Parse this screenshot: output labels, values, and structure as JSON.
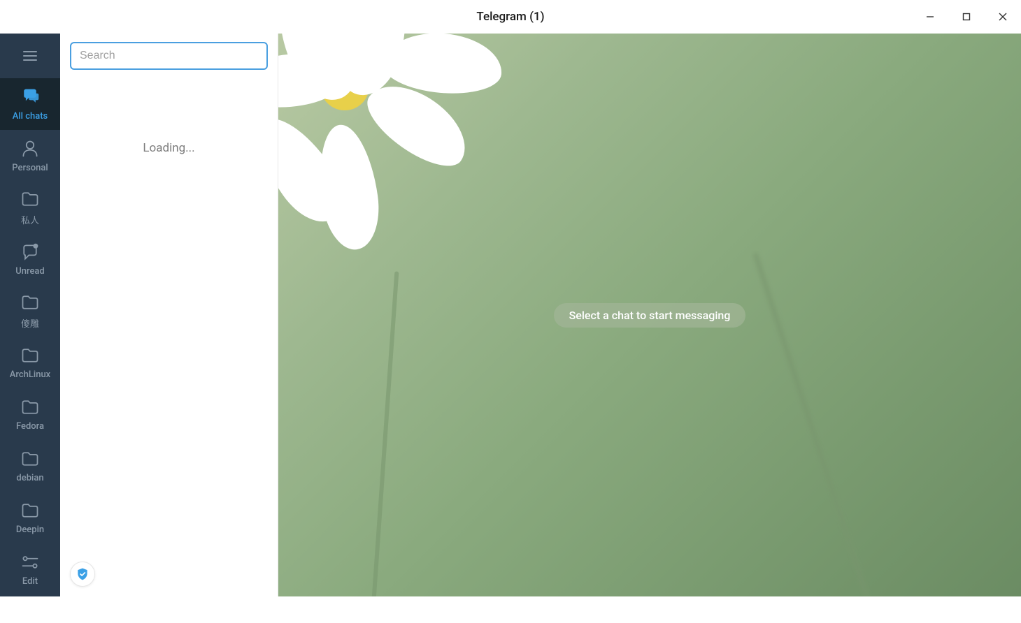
{
  "window": {
    "title": "Telegram (1)"
  },
  "search": {
    "placeholder": "Search",
    "value": ""
  },
  "chatlist": {
    "loading_text": "Loading..."
  },
  "sidebar": {
    "folders": [
      {
        "id": "all-chats",
        "label": "All chats",
        "icon": "chats",
        "active": true
      },
      {
        "id": "personal",
        "label": "Personal",
        "icon": "person",
        "active": false
      },
      {
        "id": "private",
        "label": "私人",
        "icon": "folder",
        "active": false
      },
      {
        "id": "unread",
        "label": "Unread",
        "icon": "unread",
        "active": false
      },
      {
        "id": "shadiao",
        "label": "傻雕",
        "icon": "folder",
        "active": false
      },
      {
        "id": "archlinux",
        "label": "ArchLinux",
        "icon": "folder",
        "active": false
      },
      {
        "id": "fedora",
        "label": "Fedora",
        "icon": "folder",
        "active": false
      },
      {
        "id": "debian",
        "label": "debian",
        "icon": "folder",
        "active": false
      },
      {
        "id": "deepin",
        "label": "Deepin",
        "icon": "folder",
        "active": false
      },
      {
        "id": "edit",
        "label": "Edit",
        "icon": "edit",
        "active": false
      }
    ]
  },
  "chat_area": {
    "empty_prompt": "Select a chat to start messaging"
  },
  "colors": {
    "sidebar_bg": "#293a4c",
    "sidebar_active_bg": "#18262f",
    "accent": "#3ba0e6",
    "search_border": "#4a9fe0"
  }
}
